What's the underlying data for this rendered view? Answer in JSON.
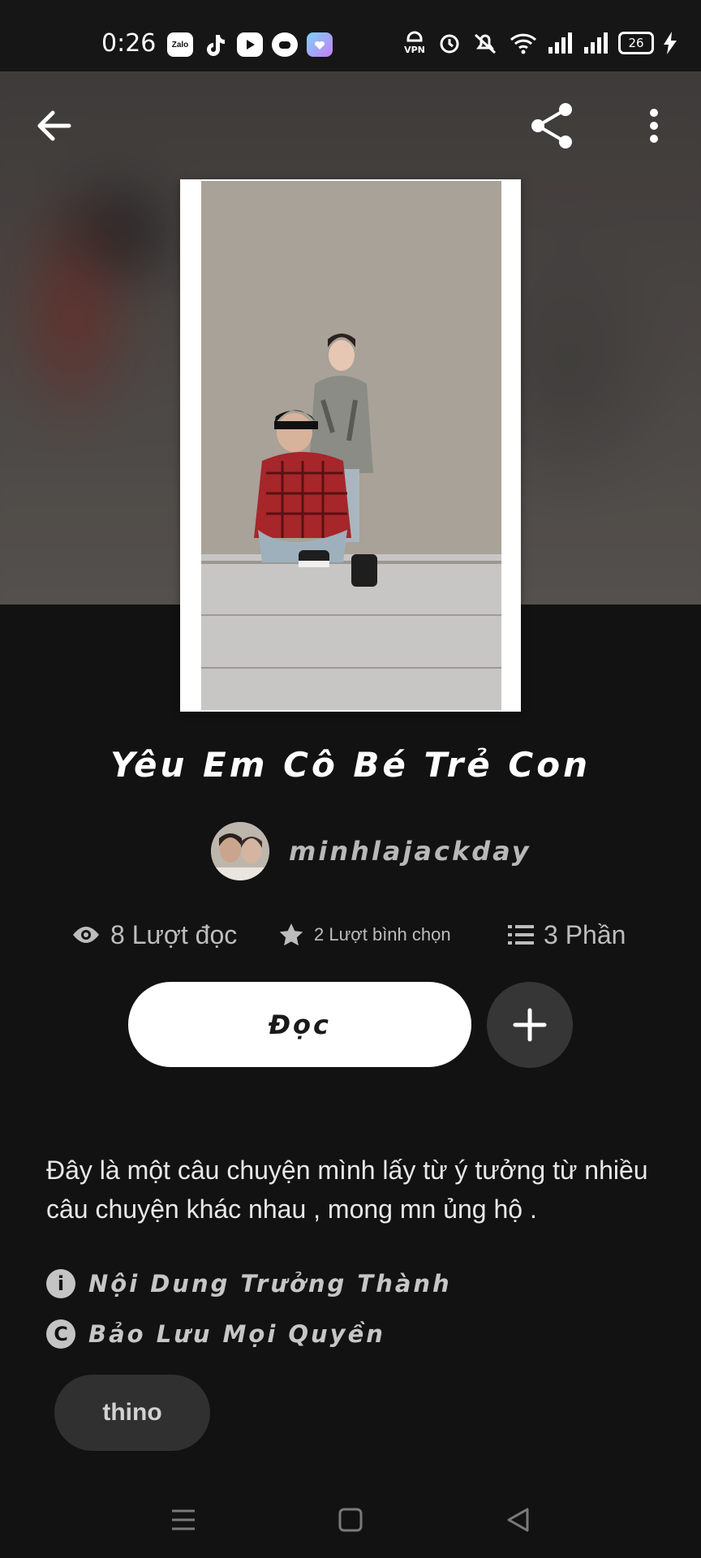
{
  "status_bar": {
    "time": "0:26",
    "app_icons": [
      "zalo-icon",
      "tiktok-icon",
      "youtube-icon",
      "game-icon",
      "app-icon"
    ],
    "app_labels": {
      "zalo": "Zalo"
    },
    "vpn_label": "VPN",
    "battery": "26"
  },
  "story": {
    "title": "Yêu Em Cô Bé Trẻ Con",
    "author": "minhlajackday",
    "stats": {
      "reads": "8 Lượt đọc",
      "votes": "2 Lượt bình chọn",
      "parts": "3 Phần"
    },
    "read_button": "Đọc",
    "description": "Đây là một câu chuyện mình lấy từ ý tưởng từ nhiều câu chuyện khác nhau , mong mn ủng hộ .",
    "rating": "Nội Dung Trưởng Thành",
    "copyright": "Bảo Lưu Mọi Quyền",
    "tag": "thino"
  },
  "colors": {
    "background": "#121213",
    "button_primary": "#ffffff",
    "button_secondary": "#363636",
    "muted_text": "#bdbdbd"
  }
}
